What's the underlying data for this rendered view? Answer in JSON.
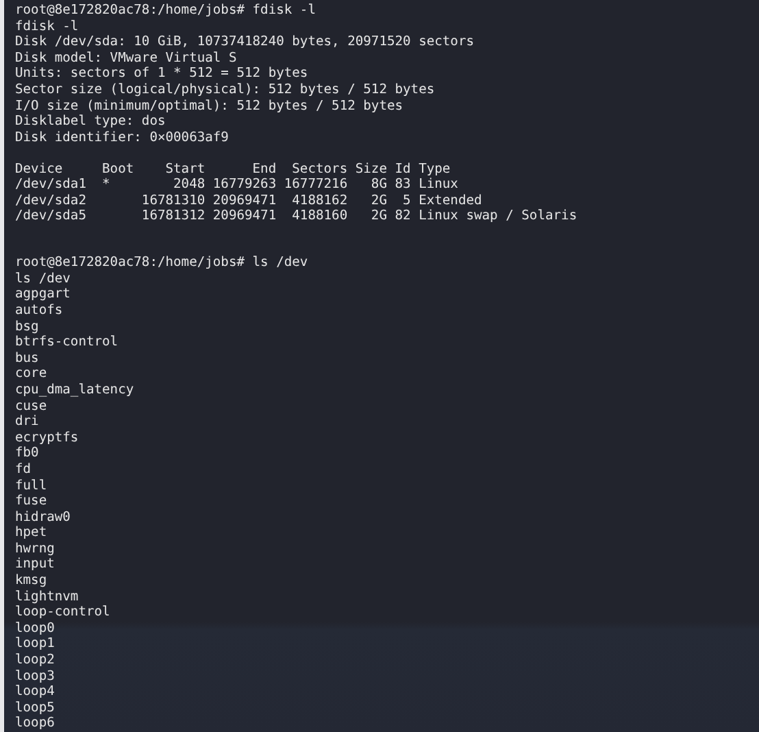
{
  "terminal": {
    "lines": [
      {
        "kind": "text",
        "text": "root@8e172820ac78:/home/jobs# fdisk -l"
      },
      {
        "kind": "text",
        "text": "fdisk -l"
      },
      {
        "kind": "text",
        "text": "Disk /dev/sda: 10 GiB, 10737418240 bytes, 20971520 sectors"
      },
      {
        "kind": "text",
        "text": "Disk model: VMware Virtual S"
      },
      {
        "kind": "text",
        "text": "Units: sectors of 1 * 512 = 512 bytes"
      },
      {
        "kind": "text",
        "text": "Sector size (logical/physical): 512 bytes / 512 bytes"
      },
      {
        "kind": "text",
        "text": "I/O size (minimum/optimal): 512 bytes / 512 bytes"
      },
      {
        "kind": "text",
        "text": "Disklabel type: dos"
      },
      {
        "kind": "text",
        "text": "Disk identifier: 0×00063af9"
      },
      {
        "kind": "blank"
      },
      {
        "kind": "text",
        "text": "Device     Boot    Start      End  Sectors Size Id Type"
      },
      {
        "kind": "text",
        "text": "/dev/sda1  *        2048 16779263 16777216   8G 83 Linux"
      },
      {
        "kind": "text",
        "text": "/dev/sda2       16781310 20969471  4188162   2G  5 Extended"
      },
      {
        "kind": "text",
        "text": "/dev/sda5       16781312 20969471  4188160   2G 82 Linux swap / Solaris"
      },
      {
        "kind": "blank"
      },
      {
        "kind": "blank"
      },
      {
        "kind": "text",
        "text": "root@8e172820ac78:/home/jobs# ls /dev"
      },
      {
        "kind": "text",
        "text": "ls /dev"
      },
      {
        "kind": "text",
        "text": "agpgart"
      },
      {
        "kind": "text",
        "text": "autofs"
      },
      {
        "kind": "text",
        "text": "bsg"
      },
      {
        "kind": "text",
        "text": "btrfs-control"
      },
      {
        "kind": "text",
        "text": "bus"
      },
      {
        "kind": "text",
        "text": "core"
      },
      {
        "kind": "text",
        "text": "cpu_dma_latency"
      },
      {
        "kind": "text",
        "text": "cuse"
      },
      {
        "kind": "text",
        "text": "dri"
      },
      {
        "kind": "text",
        "text": "ecryptfs"
      },
      {
        "kind": "text",
        "text": "fb0"
      },
      {
        "kind": "text",
        "text": "fd"
      },
      {
        "kind": "text",
        "text": "full"
      },
      {
        "kind": "text",
        "text": "fuse"
      },
      {
        "kind": "text",
        "text": "hidraw0"
      },
      {
        "kind": "text",
        "text": "hpet"
      },
      {
        "kind": "text",
        "text": "hwrng"
      },
      {
        "kind": "text",
        "text": "input"
      },
      {
        "kind": "text",
        "text": "kmsg"
      },
      {
        "kind": "text",
        "text": "lightnvm"
      },
      {
        "kind": "text",
        "text": "loop-control"
      },
      {
        "kind": "text",
        "text": "loop0"
      },
      {
        "kind": "text",
        "text": "loop1"
      },
      {
        "kind": "text",
        "text": "loop2"
      },
      {
        "kind": "text",
        "text": "loop3"
      },
      {
        "kind": "text",
        "text": "loop4"
      },
      {
        "kind": "text",
        "text": "loop5"
      },
      {
        "kind": "text",
        "text": "loop6"
      }
    ]
  }
}
